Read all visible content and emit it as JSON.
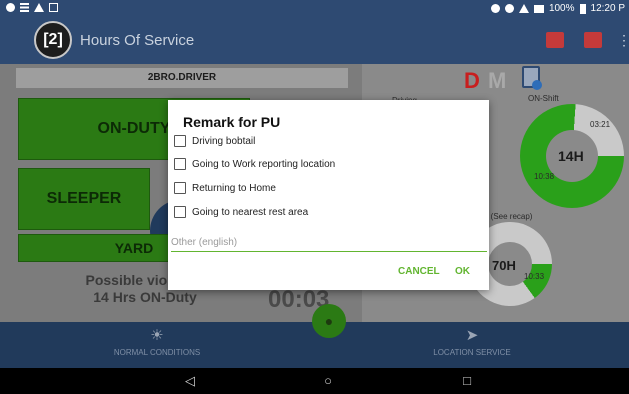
{
  "status_bar": {
    "battery": "100%",
    "time": "12:20 P"
  },
  "app_bar": {
    "logo_text": "[2]",
    "title": "Hours Of Service"
  },
  "left_panel": {
    "driver_name": "2BRO.DRIVER",
    "on_duty_label": "ON-DUTY",
    "sleeper_label": "SLEEPER",
    "yard_label": "YARD",
    "violation_line1": "Possible violation",
    "violation_line2": "14 Hrs ON-Duty",
    "timer": "00:03"
  },
  "right_panel": {
    "d_label": "D",
    "m_label": "M",
    "driving_label": "Driving",
    "on_shift_label": "ON-Shift",
    "donut_14h": {
      "center": "14H",
      "value_top": "03:21",
      "value_bottom": "10:38",
      "fraction": 0.76
    },
    "see_recap_label": "e (See recap)",
    "donut_70h": {
      "center": "70H",
      "value": "10:33",
      "fraction": 0.15
    }
  },
  "dialog": {
    "title": "Remark for PU",
    "options": [
      {
        "label": "Driving bobtail",
        "checked": false
      },
      {
        "label": "Going to Work reporting location",
        "checked": false
      },
      {
        "label": "Returning to Home",
        "checked": false
      },
      {
        "label": "Going to nearest rest area",
        "checked": false
      }
    ],
    "other_placeholder": "Other (english)",
    "other_value": "",
    "cancel_label": "CANCEL",
    "ok_label": "OK"
  },
  "bottom_nav": {
    "normal_conditions": "NORMAL CONDITIONS",
    "location_service": "LOCATION SERVICE"
  },
  "colors": {
    "app_bar": "#2e4a72",
    "status_green": "#2b7a14",
    "dialog_accent": "#62b530",
    "donut_green": "#2aa01a",
    "d_red": "#c81e1e"
  },
  "icons": {
    "android_back": "◁",
    "android_home": "○",
    "android_recents": "□"
  }
}
